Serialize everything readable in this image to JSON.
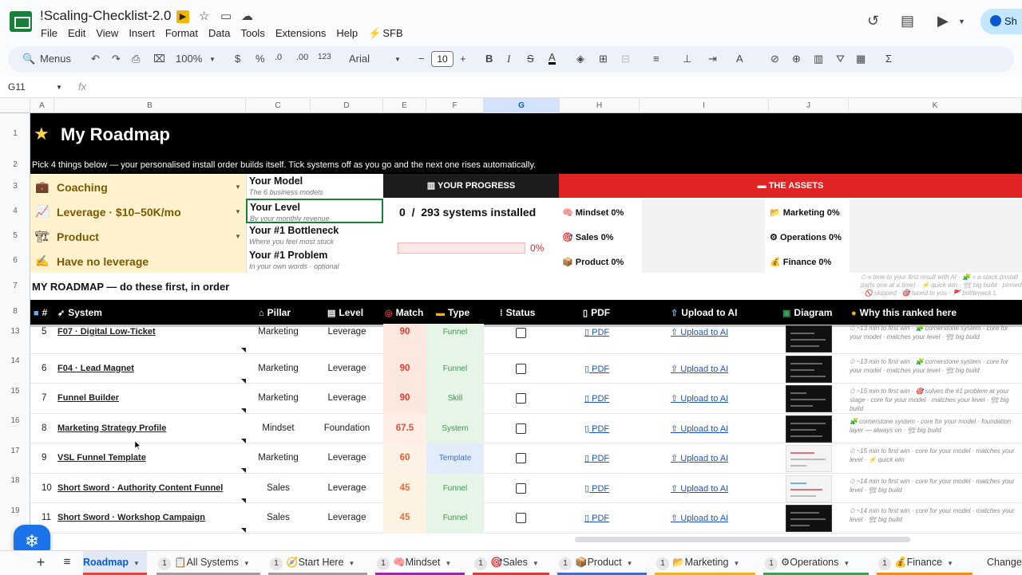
{
  "window": {
    "title": "!Scaling-Checklist-2.0"
  },
  "menu": [
    "File",
    "Edit",
    "View",
    "Insert",
    "Format",
    "Data",
    "Tools",
    "Extensions",
    "Help",
    "SFB"
  ],
  "share_label": "Sh",
  "toolbar": {
    "search": "Menus",
    "zoom": "100%",
    "currency": "$",
    "percent": "%",
    "dec_dec": ".0",
    "inc_dec": ".00",
    "fmt123": "123",
    "font": "Arial",
    "font_size": "10"
  },
  "namebox": "G11",
  "fx": "fx",
  "columns": [
    "A",
    "B",
    "C",
    "D",
    "E",
    "F",
    "G",
    "H",
    "I",
    "J",
    "K"
  ],
  "selected_column": "G",
  "row_numbers": [
    "1",
    "2",
    "3",
    "4",
    "5",
    "6",
    "7",
    "8",
    "13",
    "14",
    "15",
    "16",
    "17",
    "18",
    "19"
  ],
  "header": {
    "title": "My Roadmap",
    "instructions": "Pick 4 things below — your personalised install order builds itself. Tick systems off as you go and the next one rises automatically."
  },
  "picks": [
    {
      "icon": "💼",
      "label": "Coaching"
    },
    {
      "icon": "📈",
      "label": "Leverage · $10–50K/mo"
    },
    {
      "icon": "🏗",
      "label": "Product"
    },
    {
      "icon": "✍",
      "label": "Have no leverage"
    }
  ],
  "slots": [
    {
      "title": "Your Model",
      "hint": "The 6 business models"
    },
    {
      "title": "Your Level",
      "hint": "By your monthly revenue"
    },
    {
      "title": "Your #1 Bottleneck",
      "hint": "Where you feel most stuck"
    },
    {
      "title": "Your #1 Problem",
      "hint": "In your own words · optional"
    }
  ],
  "progress": {
    "header": "YOUR PROGRESS",
    "installed": "0",
    "sep": "/",
    "total": "293 systems installed",
    "fraction": 0,
    "percent_label": "0%"
  },
  "assets": {
    "header": "THE ASSETS",
    "items": [
      {
        "icon": "🧠",
        "label": "Mindset 0%"
      },
      {
        "icon": "🎯",
        "label": "Sales 0%"
      },
      {
        "icon": "📦",
        "label": "Product 0%"
      },
      {
        "icon": "📂",
        "label": "Marketing 0%"
      },
      {
        "icon": "⚙",
        "label": "Operations 0%"
      },
      {
        "icon": "💰",
        "label": "Finance 0%"
      }
    ]
  },
  "roadmap_heading": "MY ROADMAP — do these first, in order",
  "legend_note": "⏱ = time to your first result with AI · 🧩 = a stack (install parts one at a time) · ⚡ quick win · 🏗 big build · pinned · 🚫 skipped · 🎯 tuned to you · 🚩 bottleneck L",
  "table_headers": [
    "#",
    "System",
    "Pillar",
    "Level",
    "Match",
    "Type",
    "Status",
    "PDF",
    "Upload to AI",
    "Diagram",
    "Why this ranked here"
  ],
  "rows": [
    {
      "num": "5",
      "system": "F07 · Digital Low-Ticket",
      "pillar": "Marketing",
      "level": "Leverage",
      "match": "90",
      "type": "Funnel",
      "pdf": "PDF",
      "upload": "Upload to AI",
      "why": "⏱ ~13 min to first win · 🧩 cornerstone system · core for your model · matches your level · 🏗 big build",
      "match_bg": "#fde8e0",
      "match_color": "#e23b2e",
      "type_bg": "#e7f5e8",
      "type_color": "#3a9a4a",
      "thumb": "dark"
    },
    {
      "num": "6",
      "system": "F04 · Lead Magnet",
      "pillar": "Marketing",
      "level": "Leverage",
      "match": "90",
      "type": "Funnel",
      "pdf": "PDF",
      "upload": "Upload to AI",
      "why": "⏱ ~13 min to first win · 🧩 cornerstone system · core for your model · matches your level · 🏗 big build",
      "match_bg": "#fde8e0",
      "match_color": "#e23b2e",
      "type_bg": "#e7f5e8",
      "type_color": "#3a9a4a",
      "thumb": "dark"
    },
    {
      "num": "7",
      "system": "Funnel Builder",
      "pillar": "Marketing",
      "level": "Leverage",
      "match": "90",
      "type": "Skill",
      "pdf": "PDF",
      "upload": "Upload to AI",
      "why": "⏱ ~15 min to first win · 🎯 solves the #1 problem at your stage · core for your model · matches your level · 🏗 big build",
      "match_bg": "#fde8e0",
      "match_color": "#e23b2e",
      "type_bg": "#e7f5e8",
      "type_color": "#3a9a4a",
      "thumb": "dark"
    },
    {
      "num": "8",
      "system": "Marketing Strategy Profile",
      "pillar": "Mindset",
      "level": "Foundation",
      "match": "67.5",
      "type": "System",
      "pdf": "PDF",
      "upload": "Upload to AI",
      "why": "🧩 cornerstone system · core for your model · foundation layer — always on · 🏗 big build",
      "match_bg": "#fdeee6",
      "match_color": "#e0503a",
      "type_bg": "#e7f5e8",
      "type_color": "#3a9a4a",
      "thumb": "dark"
    },
    {
      "num": "9",
      "system": "VSL Funnel Template",
      "pillar": "Marketing",
      "level": "Leverage",
      "match": "60",
      "type": "Template",
      "pdf": "PDF",
      "upload": "Upload to AI",
      "why": "⏱ ~15 min to first win · core for your model · matches your level · ⚡ quick win",
      "match_bg": "#fef1e6",
      "match_color": "#e85c30",
      "type_bg": "#e3ecfb",
      "type_color": "#3b6fd6",
      "thumb": "light"
    },
    {
      "num": "10",
      "system": "Short Sword · Authority Content Funnel",
      "pillar": "Sales",
      "level": "Leverage",
      "match": "45",
      "type": "Funnel",
      "pdf": "PDF",
      "upload": "Upload to AI",
      "why": "⏱ ~14 min to first win · core for your model · matches your level · 🏗 big build",
      "match_bg": "#fdf3e3",
      "match_color": "#e8703a",
      "type_bg": "#e7f5e8",
      "type_color": "#3a9a4a",
      "thumb": "light"
    },
    {
      "num": "11",
      "system": "Short Sword · Workshop Campaign",
      "pillar": "Sales",
      "level": "Leverage",
      "match": "45",
      "type": "Funnel",
      "pdf": "PDF",
      "upload": "Upload to AI",
      "why": "⏱ ~14 min to first win · core for your model · matches your level · 🏗 big build",
      "match_bg": "#fdf3e3",
      "match_color": "#e8703a",
      "type_bg": "#e7f5e8",
      "type_color": "#3a9a4a",
      "thumb": "dark"
    }
  ],
  "tabs": [
    {
      "badge": "",
      "label": "Roadmap",
      "active": true,
      "color": "#ea4335"
    },
    {
      "badge": "1",
      "label": "All Systems",
      "active": false,
      "color": "#9e9e9e"
    },
    {
      "badge": "1",
      "label": "Start Here",
      "active": false,
      "color": "#9e9e9e"
    },
    {
      "badge": "1",
      "label": "Mindset",
      "active": false,
      "color": "#9c27b0"
    },
    {
      "badge": "1",
      "label": "Sales",
      "active": false,
      "color": "#e53935"
    },
    {
      "badge": "1",
      "label": "Product",
      "active": false,
      "color": "#3b6fd6"
    },
    {
      "badge": "1",
      "label": "Marketing",
      "active": false,
      "color": "#f4b400"
    },
    {
      "badge": "1",
      "label": "Operations",
      "active": false,
      "color": "#34a853"
    },
    {
      "badge": "1",
      "label": "Finance",
      "active": false,
      "color": "#fb8c00"
    },
    {
      "badge": "",
      "label": "Change",
      "active": false,
      "color": "#9e9e9e"
    }
  ],
  "tab_icons": [
    "",
    "📋",
    "🧭",
    "🧠",
    "🎯",
    "📦",
    "📂",
    "⚙",
    "💰",
    ""
  ]
}
